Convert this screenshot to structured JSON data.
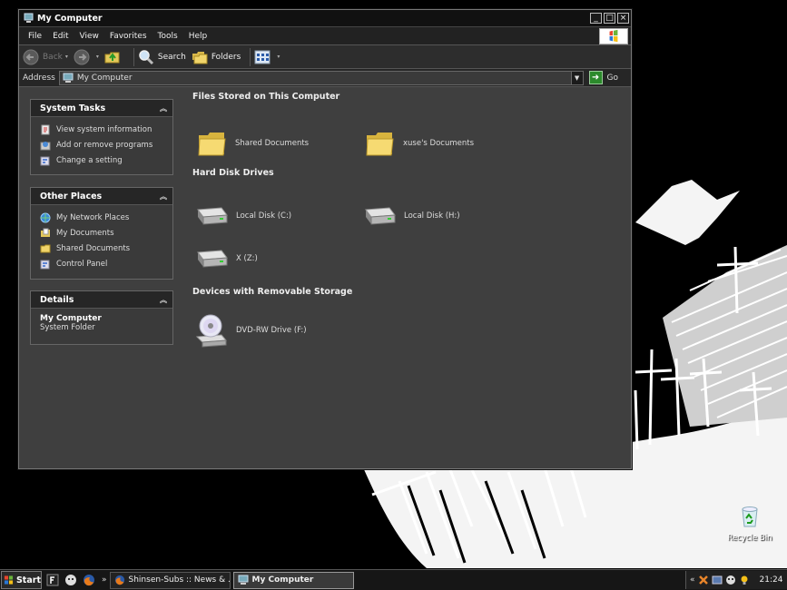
{
  "window": {
    "title": "My Computer",
    "controls": {
      "minimize": "_",
      "maximize": "□",
      "close": "×"
    }
  },
  "menu": [
    "File",
    "Edit",
    "View",
    "Favorites",
    "Tools",
    "Help"
  ],
  "toolbar": {
    "back": "Back",
    "search": "Search",
    "folders": "Folders"
  },
  "address": {
    "label": "Address",
    "value": "My Computer",
    "go": "Go"
  },
  "panes": {
    "system_tasks": {
      "title": "System Tasks",
      "items": [
        "View system information",
        "Add or remove programs",
        "Change a setting"
      ]
    },
    "other_places": {
      "title": "Other Places",
      "items": [
        "My Network Places",
        "My Documents",
        "Shared Documents",
        "Control Panel"
      ]
    },
    "details": {
      "title": "Details",
      "name": "My Computer",
      "type": "System Folder"
    }
  },
  "groups": {
    "files": {
      "title": "Files Stored on This Computer",
      "items": [
        "Shared Documents",
        "xuse's Documents"
      ]
    },
    "drives": {
      "title": "Hard Disk Drives",
      "items": [
        "Local Disk (C:)",
        "Local Disk (H:)",
        "X (Z:)"
      ]
    },
    "removable": {
      "title": "Devices with Removable Storage",
      "items": [
        "DVD-RW Drive (F:)"
      ]
    }
  },
  "desktop": {
    "recycle_bin": "Recycle Bin"
  },
  "taskbar": {
    "start": "Start",
    "tasks": [
      "Shinsen-Subs :: News & ...",
      "My Computer"
    ],
    "tray_expand": "«",
    "clock": "21:24"
  },
  "colors": {
    "window_bg": "#3f3f3f",
    "titlebar": "#111111",
    "taskbar": "#161616"
  }
}
